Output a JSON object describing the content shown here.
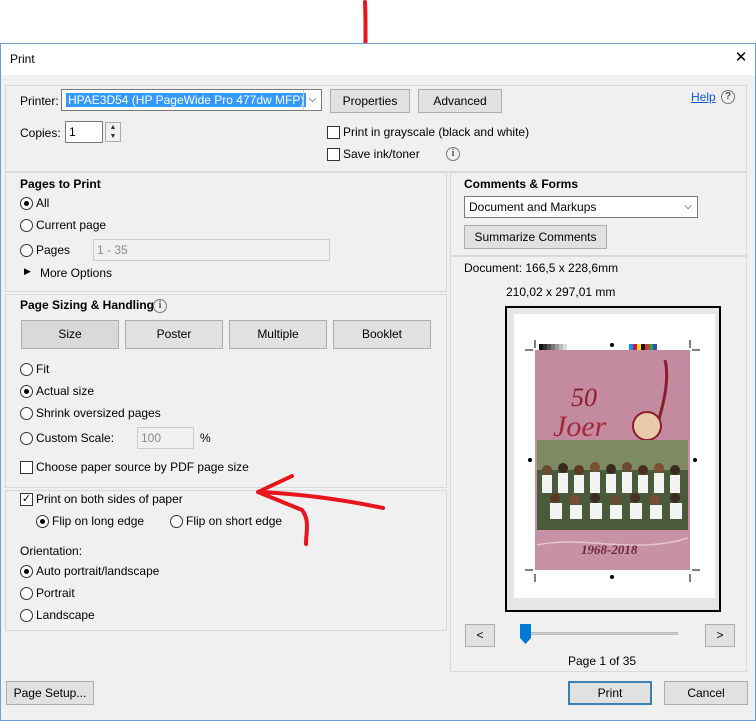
{
  "dialog": {
    "title": "Print",
    "help": "Help"
  },
  "printer": {
    "label": "Printer:",
    "selected": "HPAE3D54 (HP PageWide Pro 477dw MFP)",
    "properties_button": "Properties",
    "advanced_button": "Advanced",
    "copies_label": "Copies:",
    "copies_value": "1",
    "grayscale_label": "Print in grayscale (black and white)",
    "grayscale_checked": false,
    "save_ink_label": "Save ink/toner",
    "save_ink_checked": false
  },
  "pages_to_print": {
    "heading": "Pages to Print",
    "all": "All",
    "current_page": "Current page",
    "pages": "Pages",
    "pages_range": "1 - 35",
    "more_options": "More Options",
    "selected": "all"
  },
  "page_sizing": {
    "heading": "Page Sizing & Handling",
    "tabs": [
      "Size",
      "Poster",
      "Multiple",
      "Booklet"
    ],
    "fit": "Fit",
    "actual_size": "Actual size",
    "shrink": "Shrink oversized pages",
    "custom_scale": "Custom Scale:",
    "custom_scale_value": "100",
    "percent": "%",
    "paper_source": "Choose paper source by PDF page size",
    "selected": "actual_size"
  },
  "duplex": {
    "label": "Print on both sides of paper",
    "checked": true,
    "long_edge": "Flip on long edge",
    "short_edge": "Flip on short edge",
    "selected": "long_edge"
  },
  "orientation": {
    "heading": "Orientation:",
    "auto": "Auto portrait/landscape",
    "portrait": "Portrait",
    "landscape": "Landscape",
    "selected": "auto"
  },
  "comments_forms": {
    "heading": "Comments & Forms",
    "selected": "Document and Markups",
    "summarize_button": "Summarize Comments"
  },
  "preview": {
    "document_size": "Document: 166,5 x 228,6mm",
    "paper_size": "210,02 x 297,01 mm",
    "cover_number": "50",
    "cover_word": "Joer",
    "cover_years": "1968-2018",
    "prev_button": "<",
    "next_button": ">",
    "page_indicator": "Page 1 of 35",
    "slider_position": 0.0
  },
  "footer": {
    "page_setup_button": "Page Setup...",
    "print_button": "Print",
    "cancel_button": "Cancel"
  },
  "colors": {
    "accent": "#3399ff",
    "annotation": "#e8141e",
    "cover_pink": "#c792a6"
  }
}
